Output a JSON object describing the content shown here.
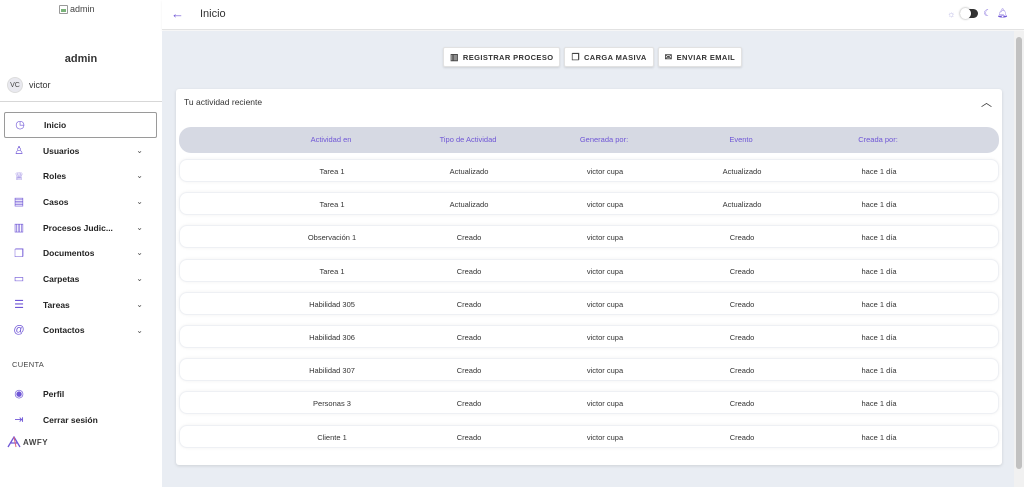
{
  "sidebar": {
    "logo_alt": "admin",
    "admin_title": "admin",
    "user": {
      "initials": "VC",
      "name": "victor"
    },
    "items": [
      {
        "label": "Inicio",
        "icon": "clock-icon",
        "glyph": "◷",
        "chevron": false,
        "active": true
      },
      {
        "label": "Usuarios",
        "icon": "user-icon",
        "glyph": "♙",
        "chevron": true
      },
      {
        "label": "Roles",
        "icon": "trophy-icon",
        "glyph": "♕",
        "chevron": true
      },
      {
        "label": "Casos",
        "icon": "briefcase-icon",
        "glyph": "▤",
        "chevron": true
      },
      {
        "label": "Procesos Judic...",
        "icon": "building-icon",
        "glyph": "▥",
        "chevron": true
      },
      {
        "label": "Documentos",
        "icon": "documents-icon",
        "glyph": "❐",
        "chevron": true
      },
      {
        "label": "Carpetas",
        "icon": "folder-icon",
        "glyph": "▭",
        "chevron": true
      },
      {
        "label": "Tareas",
        "icon": "list-icon",
        "glyph": "☰",
        "chevron": true
      },
      {
        "label": "Contactos",
        "icon": "at-icon",
        "glyph": "@",
        "chevron": true
      }
    ],
    "section_label": "CUENTA",
    "account_items": [
      {
        "label": "Perfil",
        "icon": "profile-icon",
        "glyph": "◉"
      },
      {
        "label": "Cerrar sesión",
        "icon": "logout-icon",
        "glyph": "⇥"
      }
    ],
    "brand": "AWFY"
  },
  "topbar": {
    "title": "Inicio"
  },
  "actions": [
    {
      "label": "REGISTRAR PROCESO",
      "icon": "building-icon",
      "glyph": "▥"
    },
    {
      "label": "CARGA MASIVA",
      "icon": "copy-icon",
      "glyph": "❐"
    },
    {
      "label": "ENVIAR EMAIL",
      "icon": "mail-icon",
      "glyph": "✉"
    }
  ],
  "activity": {
    "title": "Tu actividad reciente",
    "columns": [
      "Actividad en",
      "Tipo de Actividad",
      "Generada por:",
      "Evento",
      "Creada por:"
    ],
    "rows": [
      [
        "Tarea 1",
        "Actualizado",
        "victor cupa",
        "Actualizado",
        "hace 1 día"
      ],
      [
        "Tarea 1",
        "Actualizado",
        "victor cupa",
        "Actualizado",
        "hace 1 día"
      ],
      [
        "Observación 1",
        "Creado",
        "victor cupa",
        "Creado",
        "hace 1 día"
      ],
      [
        "Tarea 1",
        "Creado",
        "victor cupa",
        "Creado",
        "hace 1 día"
      ],
      [
        "Habilidad 305",
        "Creado",
        "victor cupa",
        "Creado",
        "hace 1 día"
      ],
      [
        "Habilidad 306",
        "Creado",
        "victor cupa",
        "Creado",
        "hace 1 día"
      ],
      [
        "Habilidad 307",
        "Creado",
        "victor cupa",
        "Creado",
        "hace 1 día"
      ],
      [
        "Personas 3",
        "Creado",
        "victor cupa",
        "Creado",
        "hace 1 día"
      ],
      [
        "Cliente 1",
        "Creado",
        "victor cupa",
        "Creado",
        "hace 1 día"
      ]
    ]
  },
  "colors": {
    "accent": "#6f56d6",
    "main_bg": "#e9edf3",
    "table_header_bg": "#d6d9e3"
  }
}
